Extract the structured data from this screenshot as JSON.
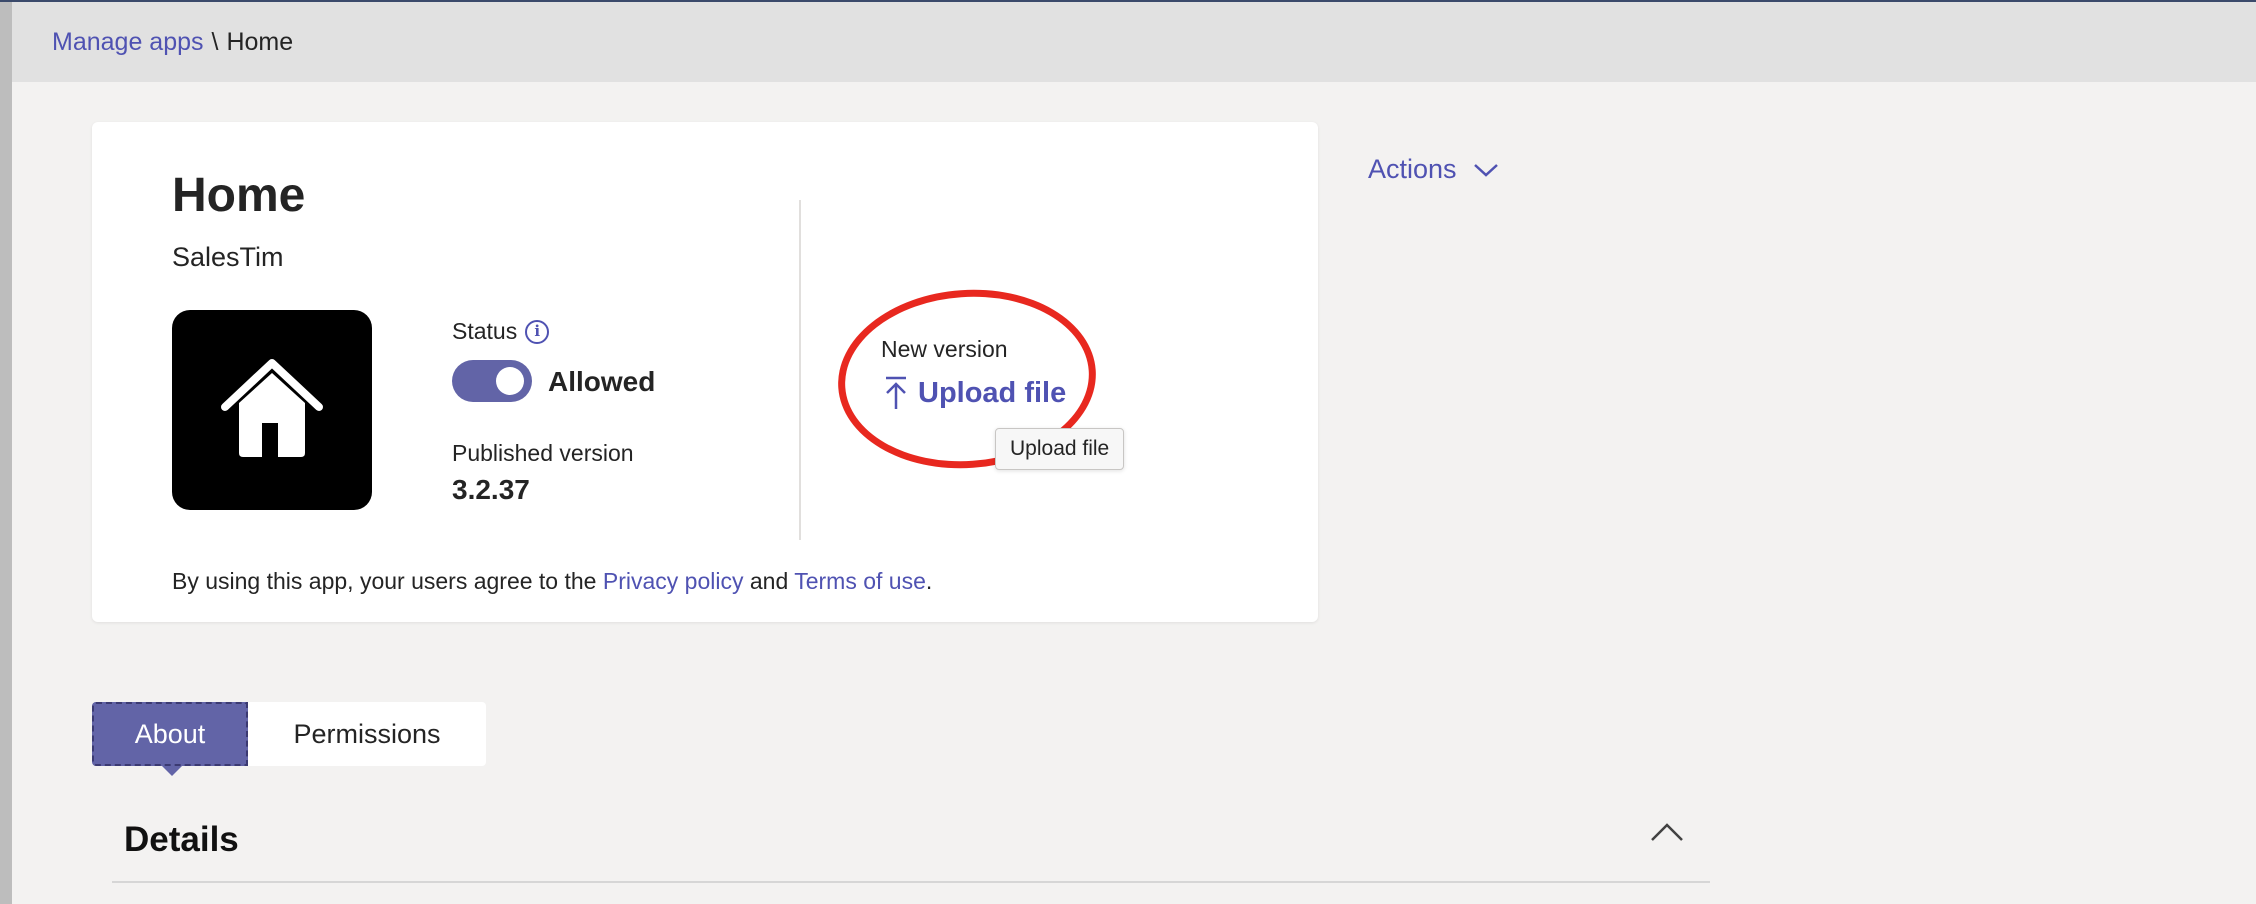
{
  "breadcrumb": {
    "parent": "Manage apps",
    "separator": "\\",
    "current": "Home"
  },
  "app": {
    "title": "Home",
    "publisher": "SalesTim",
    "icon": "home-icon",
    "status_label": "Status",
    "status_value": "Allowed",
    "status_on": true,
    "published_label": "Published version",
    "published_version": "3.2.37"
  },
  "new_version": {
    "label": "New version",
    "upload_label": "Upload file",
    "tooltip": "Upload file"
  },
  "terms": {
    "prefix": "By using this app, your users agree to the ",
    "privacy": "Privacy policy",
    "and": " and ",
    "terms": "Terms of use",
    "suffix": "."
  },
  "actions": {
    "label": "Actions"
  },
  "tabs": [
    {
      "label": "About",
      "selected": true
    },
    {
      "label": "Permissions",
      "selected": false
    }
  ],
  "details": {
    "title": "Details"
  },
  "colors": {
    "accent": "#6264a7",
    "link": "#4f52b2",
    "highlight": "#e8281f"
  }
}
